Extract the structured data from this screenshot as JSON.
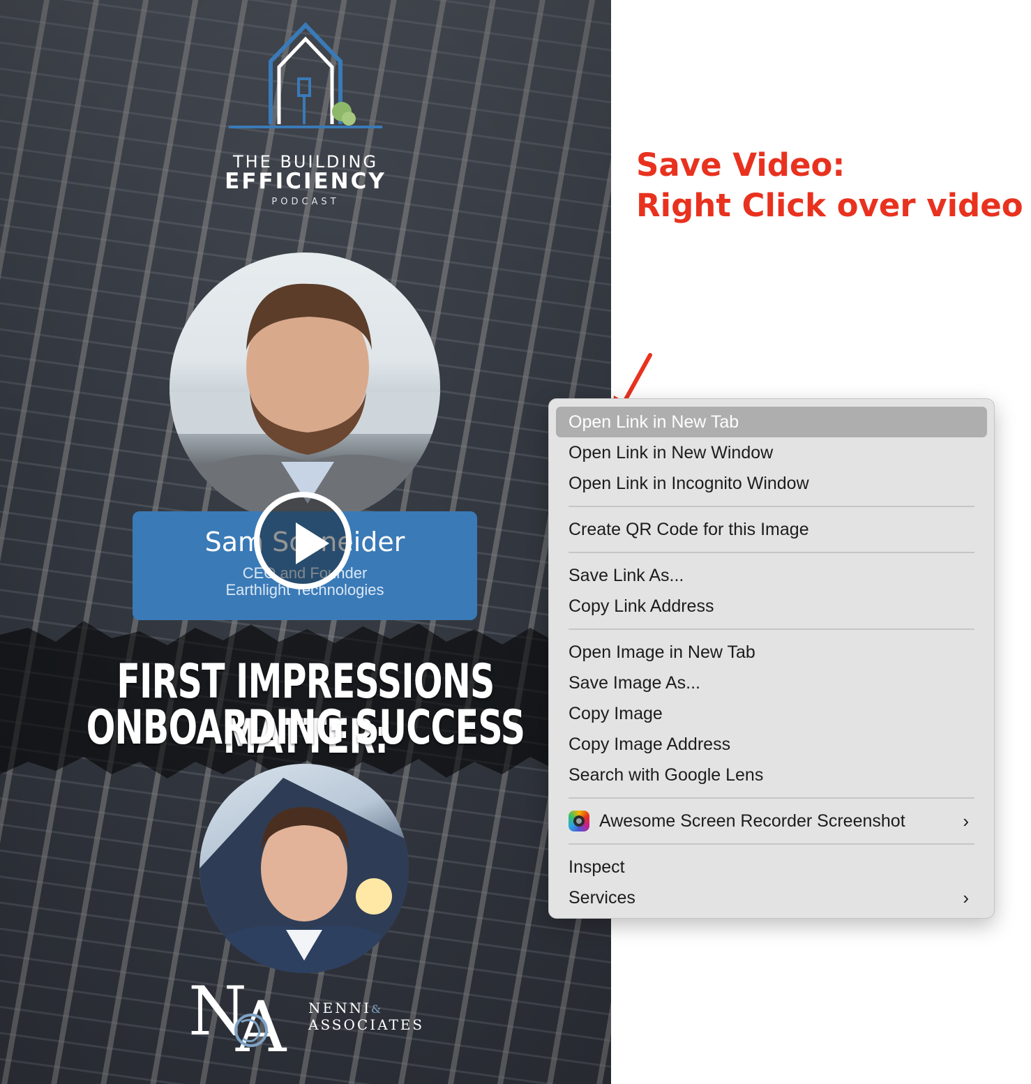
{
  "annotation": {
    "line1": "Save Video:",
    "line2": "Right Click over video",
    "color": "#e8321f"
  },
  "video": {
    "logo": {
      "line1": "THE BUILDING",
      "line2": "EFFICIENCY",
      "line3": "PODCAST"
    },
    "guest": {
      "name": "Sam Schneider",
      "role": "CEO and Founder",
      "company": "Earthlight Technologies"
    },
    "headline": {
      "line1": "FIRST IMPRESSIONS MATTER:",
      "line2": "ONBOARDING SUCCESS"
    },
    "sponsor": {
      "name_line1": "NENNI",
      "amp": "&",
      "name_line2": "ASSOCIATES"
    },
    "play_icon": "play-icon",
    "accent_color": "#3a7ab7"
  },
  "context_menu": {
    "items": [
      {
        "label": "Open Link in New Tab",
        "highlighted": true
      },
      {
        "label": "Open Link in New Window"
      },
      {
        "label": "Open Link in Incognito Window"
      },
      {
        "label": "Create QR Code for this Image"
      },
      {
        "label": "Save Link As..."
      },
      {
        "label": "Copy Link Address"
      },
      {
        "label": "Open Image in New Tab"
      },
      {
        "label": "Save Image As..."
      },
      {
        "label": "Copy Image"
      },
      {
        "label": "Copy Image Address"
      },
      {
        "label": "Search with Google Lens"
      },
      {
        "label": "Awesome Screen Recorder  Screenshot",
        "icon": "screen-recorder-icon",
        "submenu": true
      },
      {
        "label": "Inspect"
      },
      {
        "label": "Services",
        "submenu": true
      }
    ],
    "highlight_color": "#aeaeae"
  }
}
